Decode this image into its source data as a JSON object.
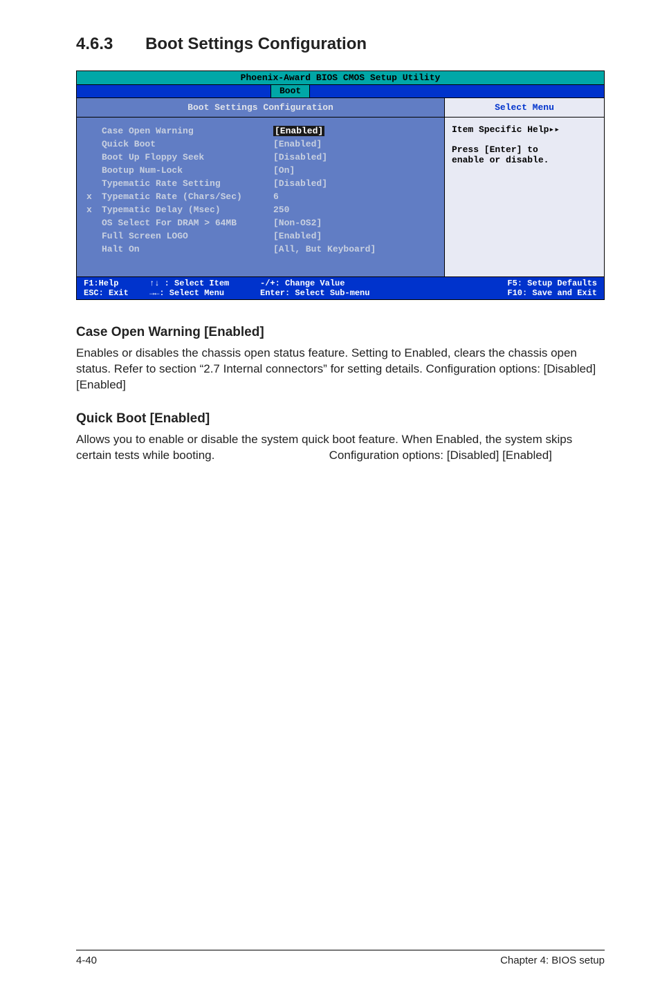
{
  "section": {
    "number": "4.6.3",
    "title": "Boot Settings Configuration"
  },
  "bios": {
    "header": "Phoenix-Award BIOS CMOS Setup Utility",
    "tab": "Boot",
    "left_header": "Boot Settings Configuration",
    "right_header": "Select Menu",
    "rows": [
      {
        "prefix": "",
        "label": "Case Open Warning",
        "value": "[Enabled]",
        "selected": true
      },
      {
        "prefix": "",
        "label": "Quick Boot",
        "value": "[Enabled]",
        "selected": false
      },
      {
        "prefix": "",
        "label": "Boot Up Floppy Seek",
        "value": "[Disabled]",
        "selected": false
      },
      {
        "prefix": "",
        "label": "Bootup Num-Lock",
        "value": "[On]",
        "selected": false
      },
      {
        "prefix": "",
        "label": "Typematic Rate Setting",
        "value": "[Disabled]",
        "selected": false
      },
      {
        "prefix": "x",
        "label": "Typematic Rate (Chars/Sec)",
        "value": "6",
        "selected": false
      },
      {
        "prefix": "x",
        "label": "Typematic Delay (Msec)",
        "value": "250",
        "selected": false
      },
      {
        "prefix": "",
        "label": "OS Select For DRAM > 64MB",
        "value": "[Non-OS2]",
        "selected": false
      },
      {
        "prefix": "",
        "label": "Full Screen LOGO",
        "value": "[Enabled]",
        "selected": false
      },
      {
        "prefix": "",
        "label": "Halt On",
        "value": "[All, But Keyboard]",
        "selected": false
      }
    ],
    "help": {
      "line1": "Item Specific Help▸▸",
      "line2": "Press [Enter] to",
      "line3": "enable or disable."
    },
    "footer": {
      "f1": "F1:Help",
      "esc": "ESC: Exit",
      "updown": "↑↓ : Select Item",
      "leftright": "→←: Select Menu",
      "change": "-/+:  Change Value",
      "enter": "Enter: Select Sub-menu",
      "f5": "F5: Setup Defaults",
      "f10": "F10: Save and Exit"
    }
  },
  "sub1": {
    "heading": "Case Open Warning [Enabled]",
    "text": "Enables or disables the chassis open status feature. Setting to Enabled, clears the chassis open status. Refer to section “2.7 Internal connectors” for setting details. Configuration options: [Disabled] [Enabled]"
  },
  "sub2": {
    "heading": "Quick Boot [Enabled]",
    "text": "Allows you to enable or disable the system quick boot feature. When Enabled, the system skips certain tests while booting.                                   Configuration options: [Disabled] [Enabled]"
  },
  "footer": {
    "left": "4-40",
    "right": "Chapter 4: BIOS setup"
  }
}
